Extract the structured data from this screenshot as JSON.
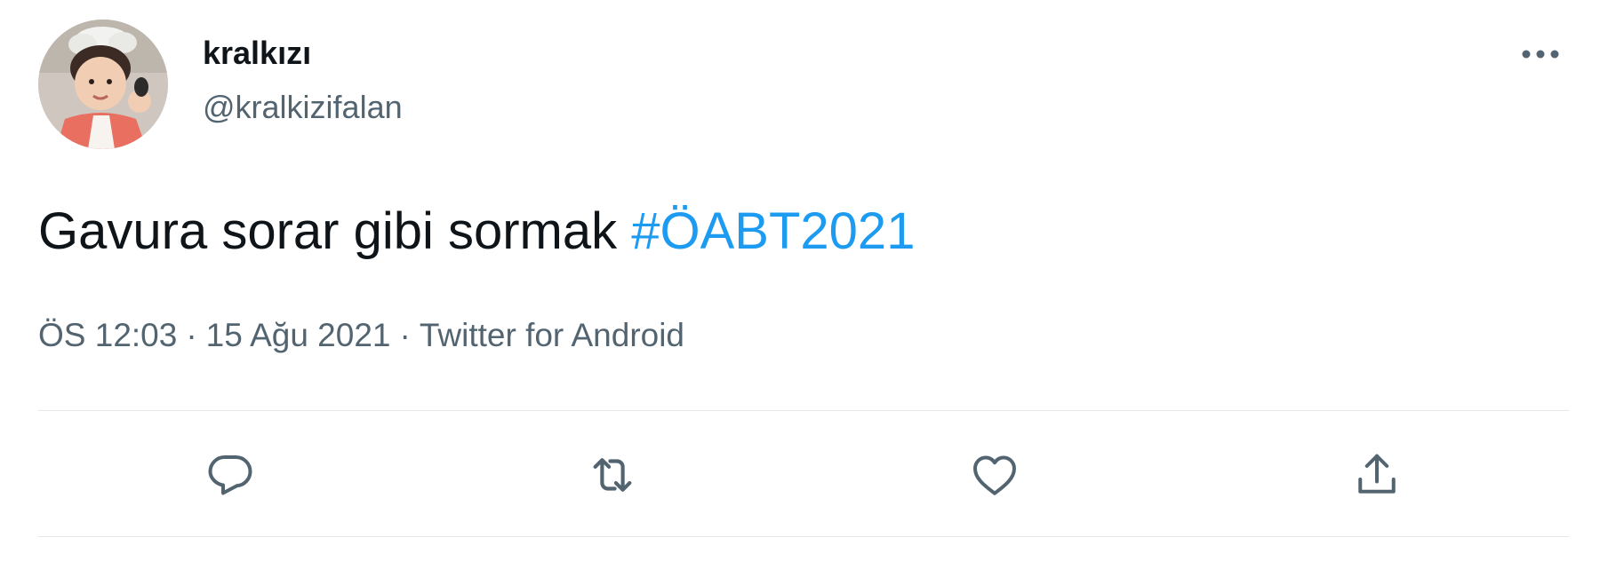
{
  "tweet": {
    "author": {
      "display_name": "kralkızı",
      "handle": "@kralkizifalan",
      "avatar_icon": "profile-photo-avatar"
    },
    "text": "Gavura sorar gibi sormak",
    "hashtag": "#ÖABT2021",
    "time": "ÖS 12:03",
    "date": "15 Ağu 2021",
    "separator": "·",
    "source": "Twitter for Android"
  },
  "actions": {
    "reply_icon": "reply-icon",
    "retweet_icon": "retweet-icon",
    "like_icon": "heart-icon",
    "share_icon": "share-icon",
    "more_icon": "more-options-icon"
  },
  "colors": {
    "text": "#0f1419",
    "secondary": "#536471",
    "hashtag": "#1d9bf0",
    "divider": "#e3e7ea"
  }
}
